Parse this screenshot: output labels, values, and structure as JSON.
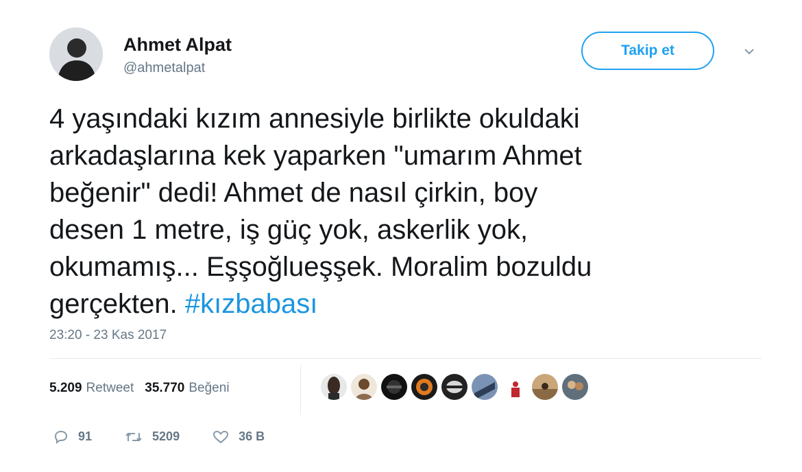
{
  "author": {
    "name": "Ahmet Alpat",
    "handle": "@ahmetalpat"
  },
  "follow_label": "Takip et",
  "tweet": {
    "lines": [
      "4 yaşındaki kızım annesiyle birlikte okuldaki",
      "arkadaşlarına kek yaparken \"umarım Ahmet",
      "beğenir\" dedi! Ahmet de nasıl çirkin, boy",
      "desen 1 metre, iş güç yok, askerlik yok,",
      "okumamış... Eşşoğlueşşek. Moralim bozuldu"
    ],
    "last_line": "gerçekten.",
    "hashtag": "#kızbabası"
  },
  "timestamp": "23:20 - 23 Kas 2017",
  "stats": {
    "retweet_count": "5.209",
    "retweet_label": "Retweet",
    "like_count": "35.770",
    "like_label": "Beğeni"
  },
  "actions": {
    "reply_count": "91",
    "retweet_count": "5209",
    "like_count": "36 B"
  },
  "colors": {
    "accent": "#1da1f2",
    "hashtag": "#1b95e0",
    "muted": "#657786"
  },
  "icons": [
    "chevron-down-icon",
    "reply-icon",
    "retweet-icon",
    "heart-icon"
  ]
}
